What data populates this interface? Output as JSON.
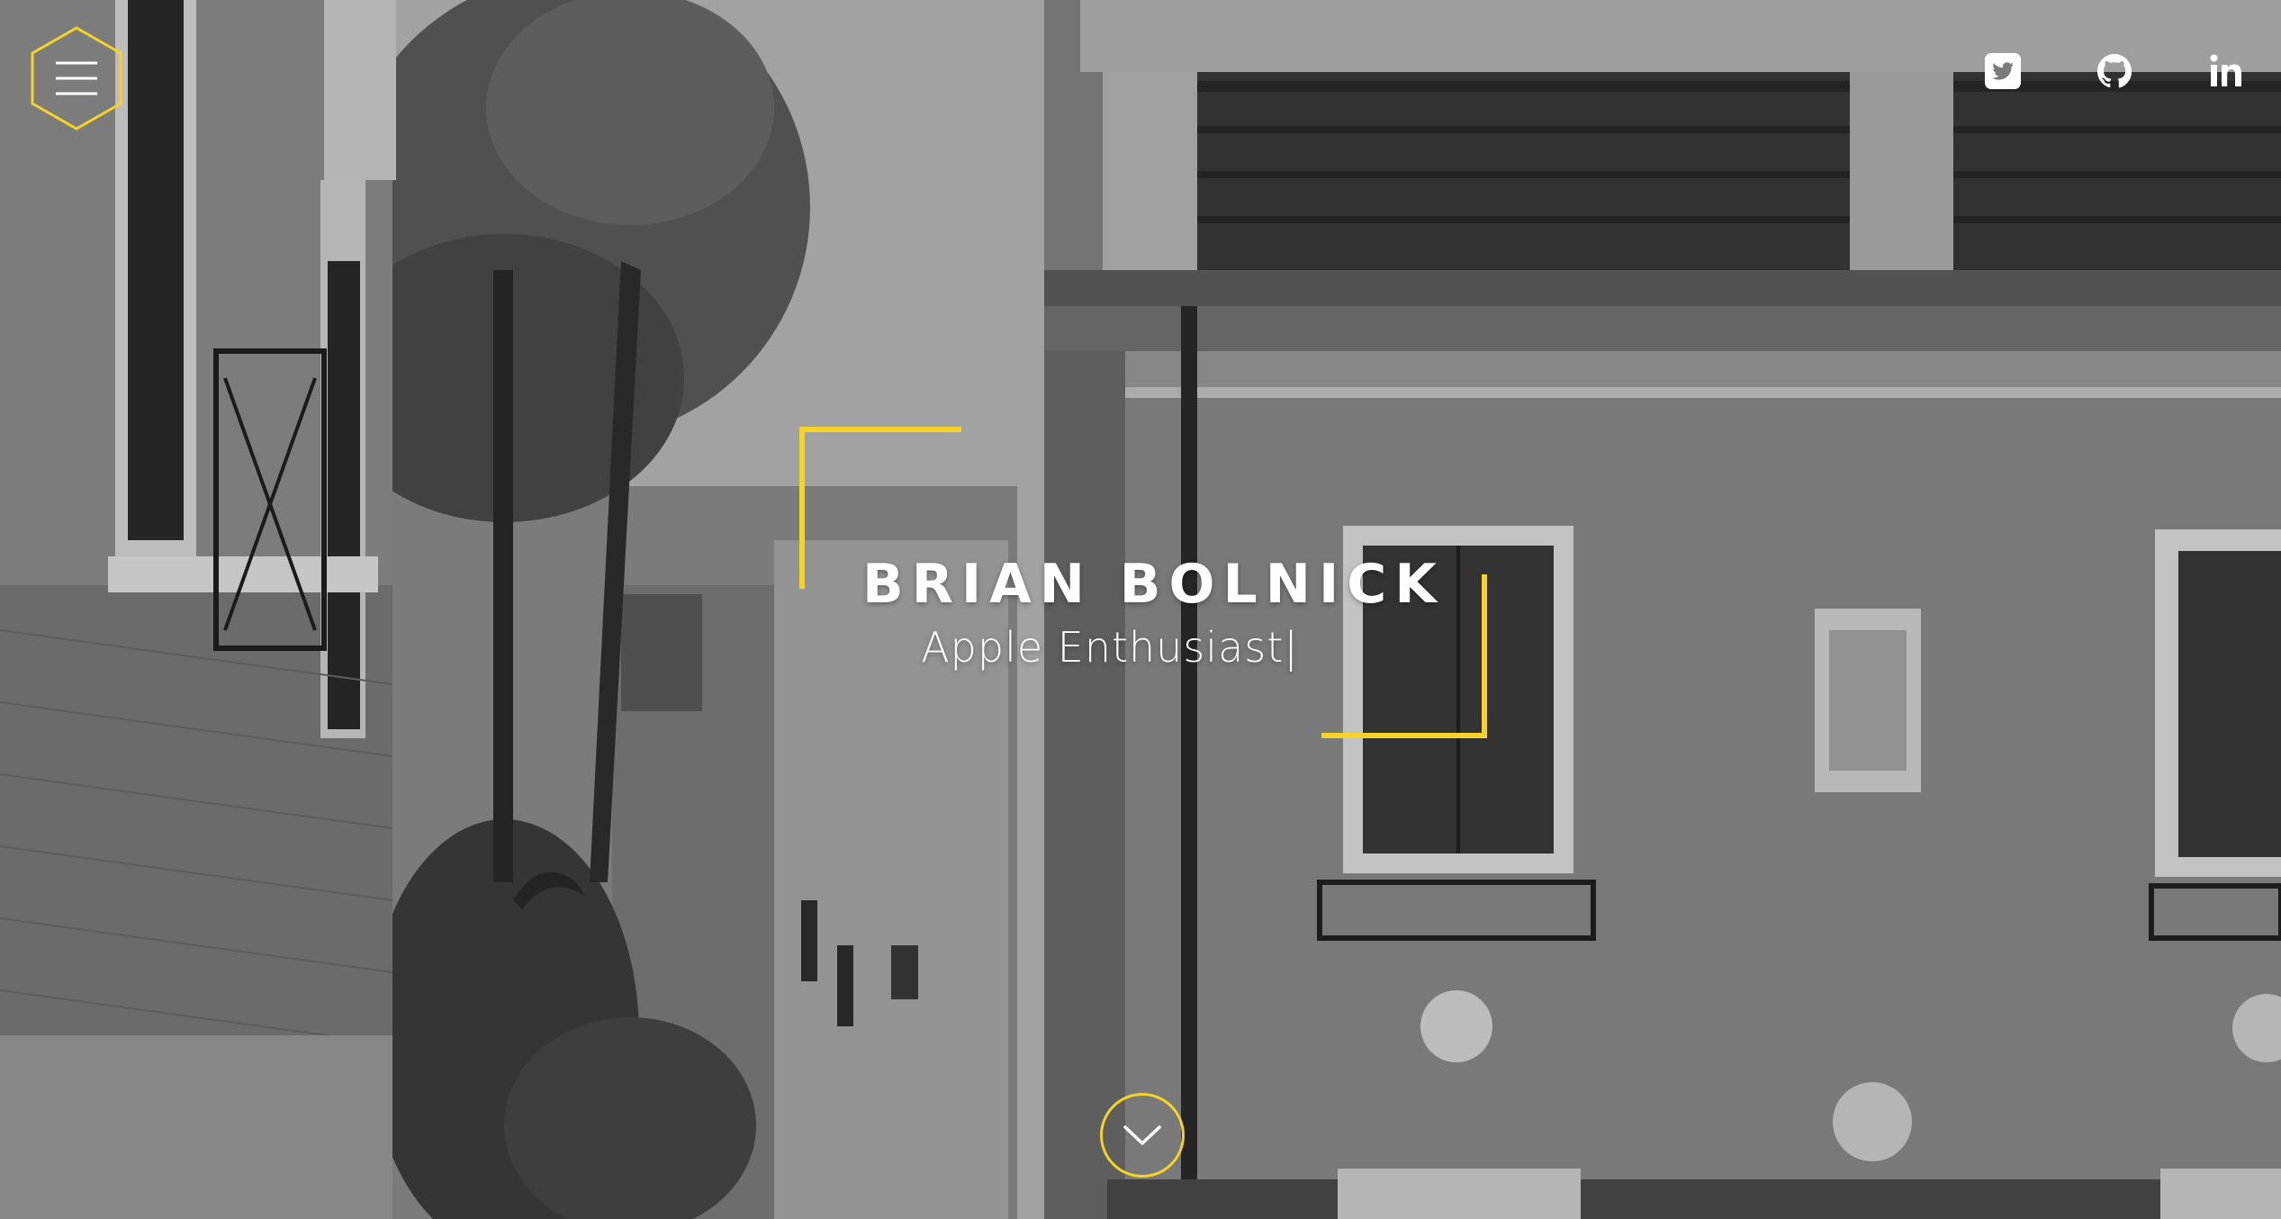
{
  "hero": {
    "name": "BRIAN BOLNICK",
    "tagline": "Apple Enthusiast",
    "cursor": "|"
  },
  "nav": {
    "menu_icon": "hamburger-in-hexagon-icon"
  },
  "social": [
    {
      "name": "twitter",
      "icon": "twitter-icon"
    },
    {
      "name": "github",
      "icon": "github-icon"
    },
    {
      "name": "linkedin",
      "icon": "linkedin-icon"
    }
  ],
  "scroll": {
    "icon": "chevron-down-icon"
  },
  "colors": {
    "accent": "#f5d327",
    "text": "#ffffff",
    "background_tone": "#7a7a7a"
  }
}
